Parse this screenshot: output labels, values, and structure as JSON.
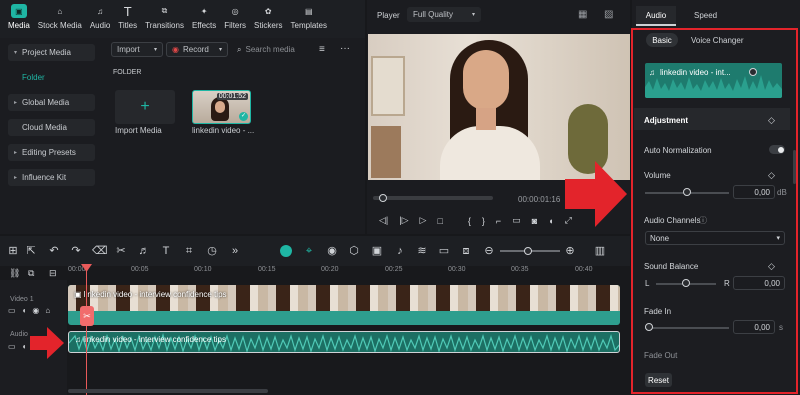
{
  "toolbar": {
    "tabs": [
      {
        "label": "Media",
        "icon": "media-icon"
      },
      {
        "label": "Stock Media",
        "icon": "stock-media-icon"
      },
      {
        "label": "Audio",
        "icon": "audio-icon"
      },
      {
        "label": "Titles",
        "icon": "titles-icon"
      },
      {
        "label": "Transitions",
        "icon": "transitions-icon"
      },
      {
        "label": "Effects",
        "icon": "effects-icon"
      },
      {
        "label": "Filters",
        "icon": "filters-icon"
      },
      {
        "label": "Stickers",
        "icon": "stickers-icon"
      },
      {
        "label": "Templates",
        "icon": "templates-icon"
      }
    ]
  },
  "leftnav": {
    "project_media": "Project Media",
    "folder": "Folder",
    "global_media": "Global Media",
    "cloud_media": "Cloud Media",
    "editing_presets": "Editing Presets",
    "influence_kit": "Influence Kit"
  },
  "media": {
    "import_label": "Import",
    "record_label": "Record",
    "search_placeholder": "Search media",
    "folder_heading": "FOLDER",
    "import_tile_label": "Import Media",
    "clip_label": "linkedin video - ...",
    "clip_duration": "00:01:52"
  },
  "player": {
    "label": "Player",
    "quality": "Full Quality",
    "timecode": "00:00:01:16"
  },
  "right": {
    "tab_audio": "Audio",
    "tab_speed": "Speed",
    "sub_basic": "Basic",
    "sub_voice": "Voice Changer",
    "wave_label": "linkedin video - int...",
    "adjustment": "Adjustment",
    "auto_norm": "Auto Normalization",
    "volume": "Volume",
    "volume_value": "0,00",
    "volume_unit": "dB",
    "volume_level": 0.5,
    "channels": "Audio Channels",
    "channels_value": "None",
    "balance": "Sound Balance",
    "balance_l": "L",
    "balance_r": "R",
    "balance_value": "0,00",
    "balance_level": 0.5,
    "fadein": "Fade In",
    "fadein_value": "0,00",
    "fadein_unit": "s",
    "fadeout": "Fade Out",
    "reset": "Reset"
  },
  "timeline": {
    "ticks": [
      "00:00",
      "00:05",
      "00:10",
      "00:15",
      "00:20",
      "00:25",
      "00:30",
      "00:35",
      "00:40"
    ],
    "video_track": "Video 1",
    "audio_track": "Audio",
    "video_clip": "linkedin video - interview confidence tips",
    "audio_clip": "linkedin video - interview confidence tips"
  },
  "colors": {
    "accent": "#1fb6a4",
    "highlight": "#e3242b",
    "clip": "#2e9e8e"
  }
}
